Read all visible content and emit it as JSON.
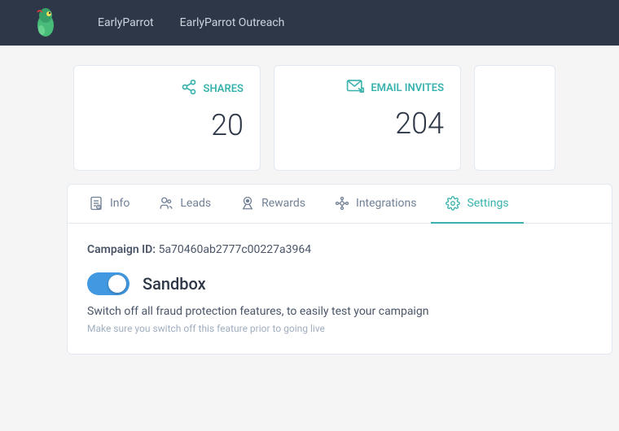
{
  "navbar": {
    "logo_alt": "EarlyParrot",
    "links": [
      {
        "label": "EarlyParrot",
        "id": "earlyparrot-link"
      },
      {
        "label": "EarlyParrot Outreach",
        "id": "earlyparrot-outreach-link"
      }
    ]
  },
  "stats": [
    {
      "id": "shares-card",
      "label": "SHARES",
      "value": "20"
    },
    {
      "id": "email-invites-card",
      "label": "EMAIL INVITES",
      "value": "204"
    },
    {
      "id": "third-card",
      "label": "",
      "value": ""
    }
  ],
  "tabs": [
    {
      "id": "tab-info",
      "label": "Info",
      "active": false
    },
    {
      "id": "tab-leads",
      "label": "Leads",
      "active": false
    },
    {
      "id": "tab-rewards",
      "label": "Rewards",
      "active": false
    },
    {
      "id": "tab-integrations",
      "label": "Integrations",
      "active": false
    },
    {
      "id": "tab-settings",
      "label": "Settings",
      "active": true
    }
  ],
  "settings": {
    "campaign_id_label": "Campaign ID:",
    "campaign_id_value": "5a70460ab2777c00227a3964",
    "sandbox_label": "Sandbox",
    "sandbox_desc": "Switch off all fraud protection features, to easily test your campaign",
    "sandbox_warning": "Make sure you switch off this feature prior to going live",
    "toggle_on": true
  }
}
